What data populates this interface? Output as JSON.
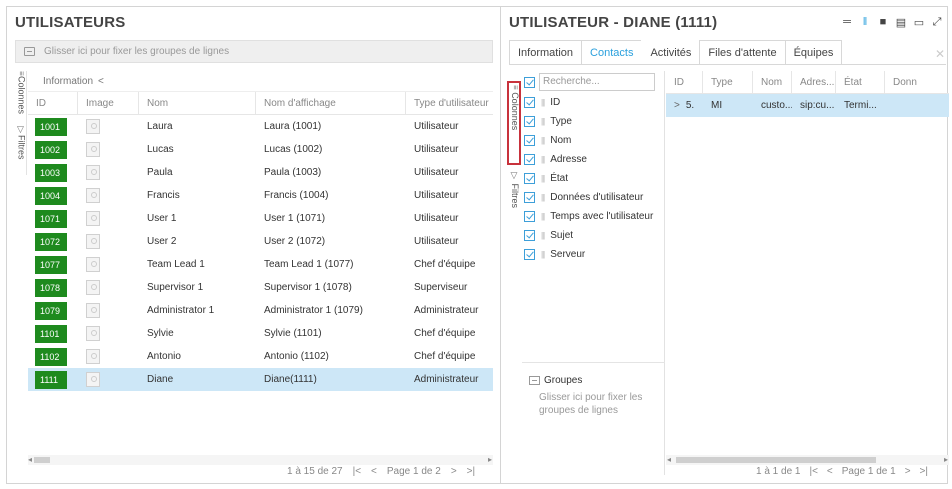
{
  "left": {
    "title": "UTILISATEURS",
    "group_hint": "Glisser ici pour fixer les groupes de lignes",
    "rail": {
      "columns": "Colonnes",
      "filters": "Filtres"
    },
    "breadcrumb": "Information",
    "columns": [
      "ID",
      "Image",
      "Nom",
      "Nom d'affichage",
      "Type d'utilisateur"
    ],
    "rows": [
      {
        "id": "1001",
        "nom": "Laura",
        "affichage": "Laura (1001)",
        "type": "Utilisateur"
      },
      {
        "id": "1002",
        "nom": "Lucas",
        "affichage": "Lucas (1002)",
        "type": "Utilisateur"
      },
      {
        "id": "1003",
        "nom": "Paula",
        "affichage": "Paula (1003)",
        "type": "Utilisateur"
      },
      {
        "id": "1004",
        "nom": "Francis",
        "affichage": "Francis (1004)",
        "type": "Utilisateur"
      },
      {
        "id": "1071",
        "nom": "User 1",
        "affichage": "User 1 (1071)",
        "type": "Utilisateur"
      },
      {
        "id": "1072",
        "nom": "User 2",
        "affichage": "User 2 (1072)",
        "type": "Utilisateur"
      },
      {
        "id": "1077",
        "nom": "Team Lead 1",
        "affichage": "Team Lead 1 (1077)",
        "type": "Chef d'équipe"
      },
      {
        "id": "1078",
        "nom": "Supervisor 1",
        "affichage": "Supervisor 1 (1078)",
        "type": "Superviseur"
      },
      {
        "id": "1079",
        "nom": "Administrator 1",
        "affichage": "Administrator 1 (1079)",
        "type": "Administrateur"
      },
      {
        "id": "1101",
        "nom": "Sylvie",
        "affichage": "Sylvie (1101)",
        "type": "Chef d'équipe"
      },
      {
        "id": "1102",
        "nom": "Antonio",
        "affichage": "Antonio (1102)",
        "type": "Chef d'équipe"
      },
      {
        "id": "1111",
        "nom": "Diane",
        "affichage": "Diane(1111)",
        "type": "Administrateur"
      }
    ],
    "pager": {
      "range": "1 à 15 de 27",
      "page": "Page 1 de 2"
    }
  },
  "right": {
    "title": "UTILISATEUR - DIANE (1111)",
    "tabs": [
      "Information",
      "Contacts",
      "Activités",
      "Files d'attente",
      "Équipes"
    ],
    "active_tab": "Contacts",
    "rail": {
      "columns": "Colonnes",
      "filters": "Filtres"
    },
    "search_placeholder": "Recherche...",
    "column_list": [
      "ID",
      "Type",
      "Nom",
      "Adresse",
      "État",
      "Données d'utilisateur",
      "Temps avec l'utilisateur",
      "Sujet",
      "Serveur"
    ],
    "groups_title": "Groupes",
    "groups_hint": "Glisser ici pour fixer les groupes de lignes",
    "grid_columns": [
      "ID",
      "Type",
      "Nom",
      "Adres...",
      "État",
      "Donn"
    ],
    "grid_row": {
      "id": "5.",
      "type": "MI",
      "nom": "custo...",
      "adresse": "sip:cu...",
      "etat": "Termi..."
    },
    "pager": {
      "range": "1 à 1 de 1",
      "page": "Page 1 de 1"
    }
  },
  "colors": {
    "accent": "#2aa0dd",
    "badge_green": "#1e8a1e",
    "selection": "#cde7f7",
    "highlight_red": "#c8323c"
  }
}
